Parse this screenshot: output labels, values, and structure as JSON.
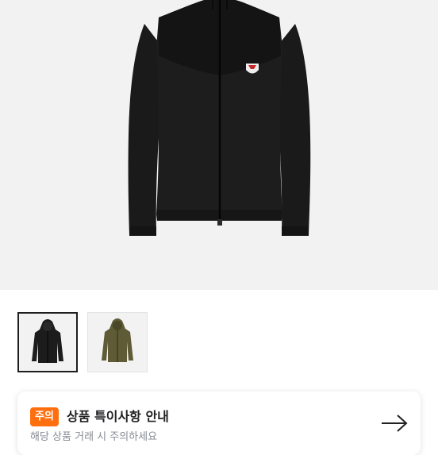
{
  "product_image": {
    "alt_icon": "jacket-black-front-image"
  },
  "thumbnails": [
    {
      "name": "thumbnail-black-jacket",
      "selected": true,
      "color": "#1c1c1c"
    },
    {
      "name": "thumbnail-khaki-jacket",
      "selected": false,
      "color": "#5e5b36"
    }
  ],
  "notice": {
    "badge": "주의",
    "title": "상품 특이사항 안내",
    "subtitle": "해당 상품 거래 시 주의하세요",
    "arrow_icon": "arrow-right-icon",
    "accent_color": "#ff6f0f"
  }
}
